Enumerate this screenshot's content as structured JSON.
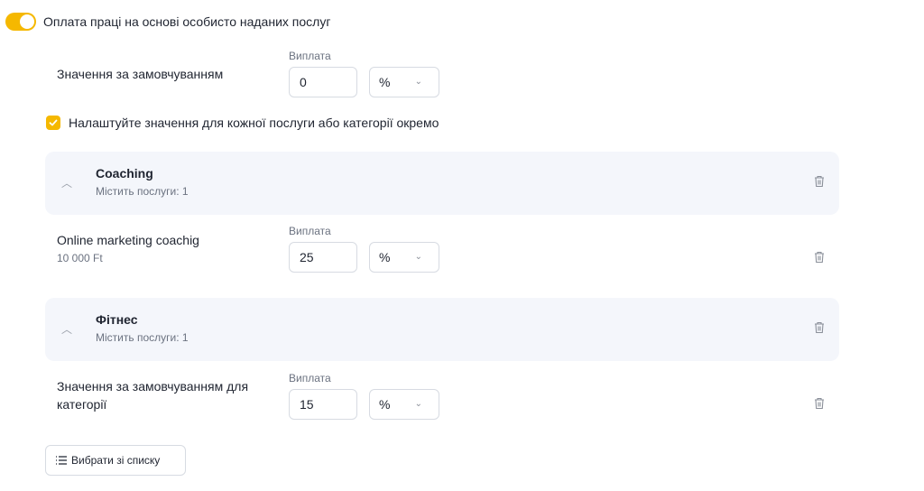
{
  "toggle": {
    "label": "Оплата праці на основі особисто наданих послуг",
    "on": true
  },
  "default_row": {
    "label": "Значення за замовчуванням",
    "field_label": "Виплата",
    "value": "0",
    "unit": "%"
  },
  "checkbox": {
    "label": "Налаштуйте значення для кожної послуги або категорії окремо",
    "checked": true
  },
  "categories": [
    {
      "title": "Coaching",
      "sub": "Містить послуги: 1",
      "item": {
        "name": "Online marketing coachig",
        "price": "10 000 Ft",
        "field_label": "Виплата",
        "value": "25",
        "unit": "%"
      }
    },
    {
      "title": "Фітнес",
      "sub": "Містить послуги: 1",
      "item": {
        "name_line1": "Значення за замовчуванням для",
        "name_line2": "категорії",
        "field_label": "Виплата",
        "value": "15",
        "unit": "%"
      }
    }
  ],
  "list_button": {
    "label": "Вибрати зі списку"
  },
  "colors": {
    "accent": "#f5b800",
    "category_bg": "#f4f6fb",
    "border": "#d7dbe2"
  }
}
